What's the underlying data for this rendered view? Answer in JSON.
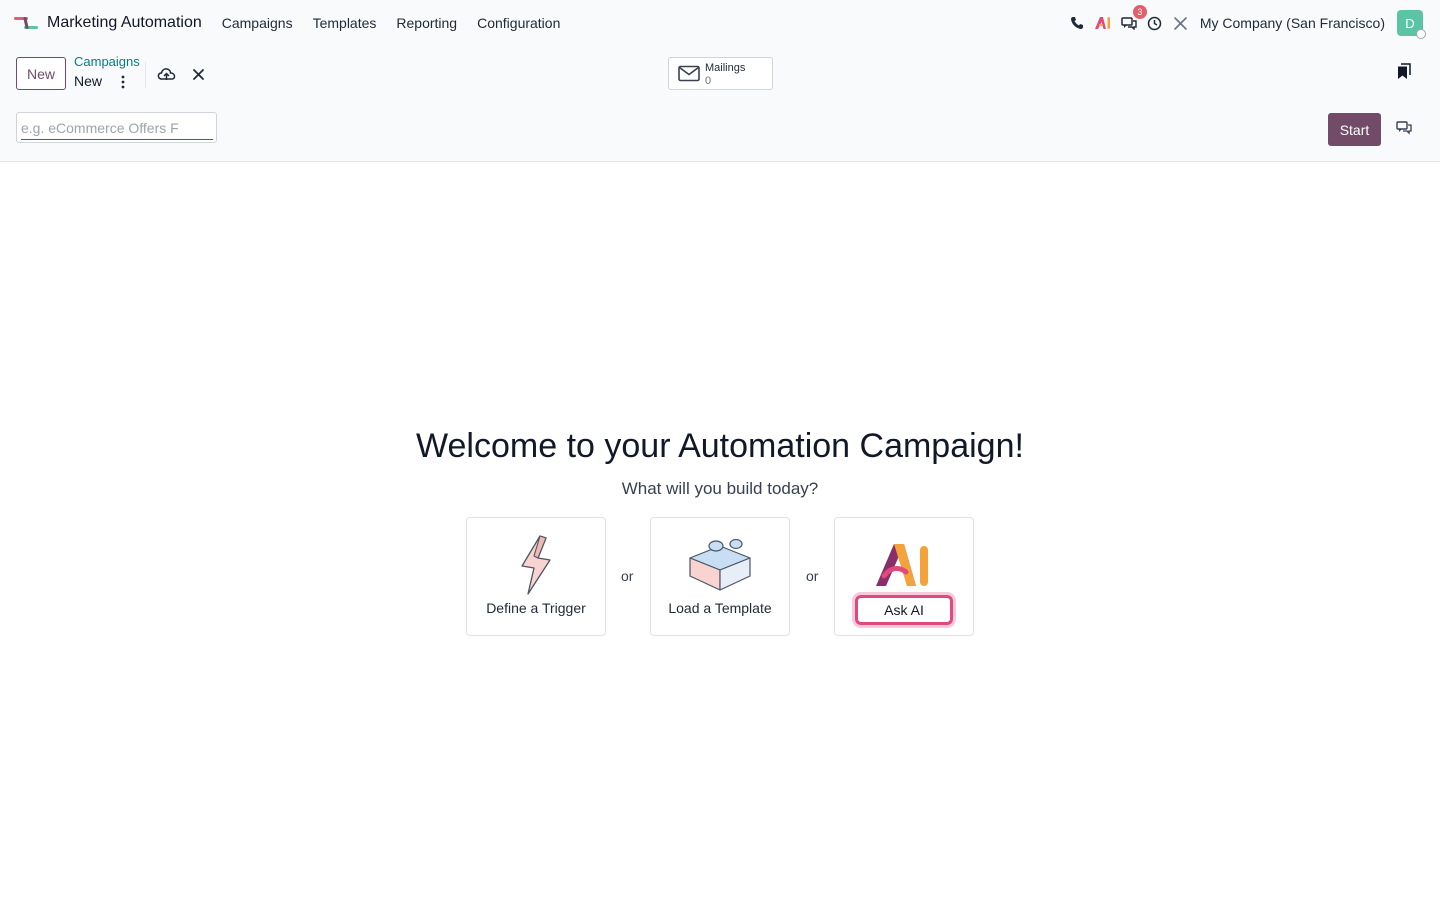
{
  "navbar": {
    "app_name": "Marketing Automation",
    "menu": [
      "Campaigns",
      "Templates",
      "Reporting",
      "Configuration"
    ],
    "messages_badge": "3",
    "company": "My Company (San Francisco)",
    "avatar_letter": "D",
    "icons": [
      "phone-icon",
      "ai-icon",
      "messages-icon",
      "clock-icon",
      "tools-icon"
    ]
  },
  "control": {
    "new_label": "New",
    "breadcrumb_parent": "Campaigns",
    "breadcrumb_current": "New",
    "smart_button": {
      "label": "Mailings",
      "value": "0"
    }
  },
  "form": {
    "name_placeholder": "e.g. eCommerce Offers F",
    "name_value": "",
    "start_label": "Start"
  },
  "main": {
    "title": "Welcome to your Automation Campaign!",
    "subtitle": "What will you build today?",
    "or_label": "or",
    "cards": {
      "trigger": "Define a Trigger",
      "template": "Load a Template",
      "ai": "Ask AI"
    }
  },
  "colors": {
    "brand_primary": "#714b67",
    "accent_teal": "#017e84",
    "badge_red": "#e35d6a",
    "avatar_green": "#5bc4a3",
    "ai_highlight": "#e0497c"
  }
}
